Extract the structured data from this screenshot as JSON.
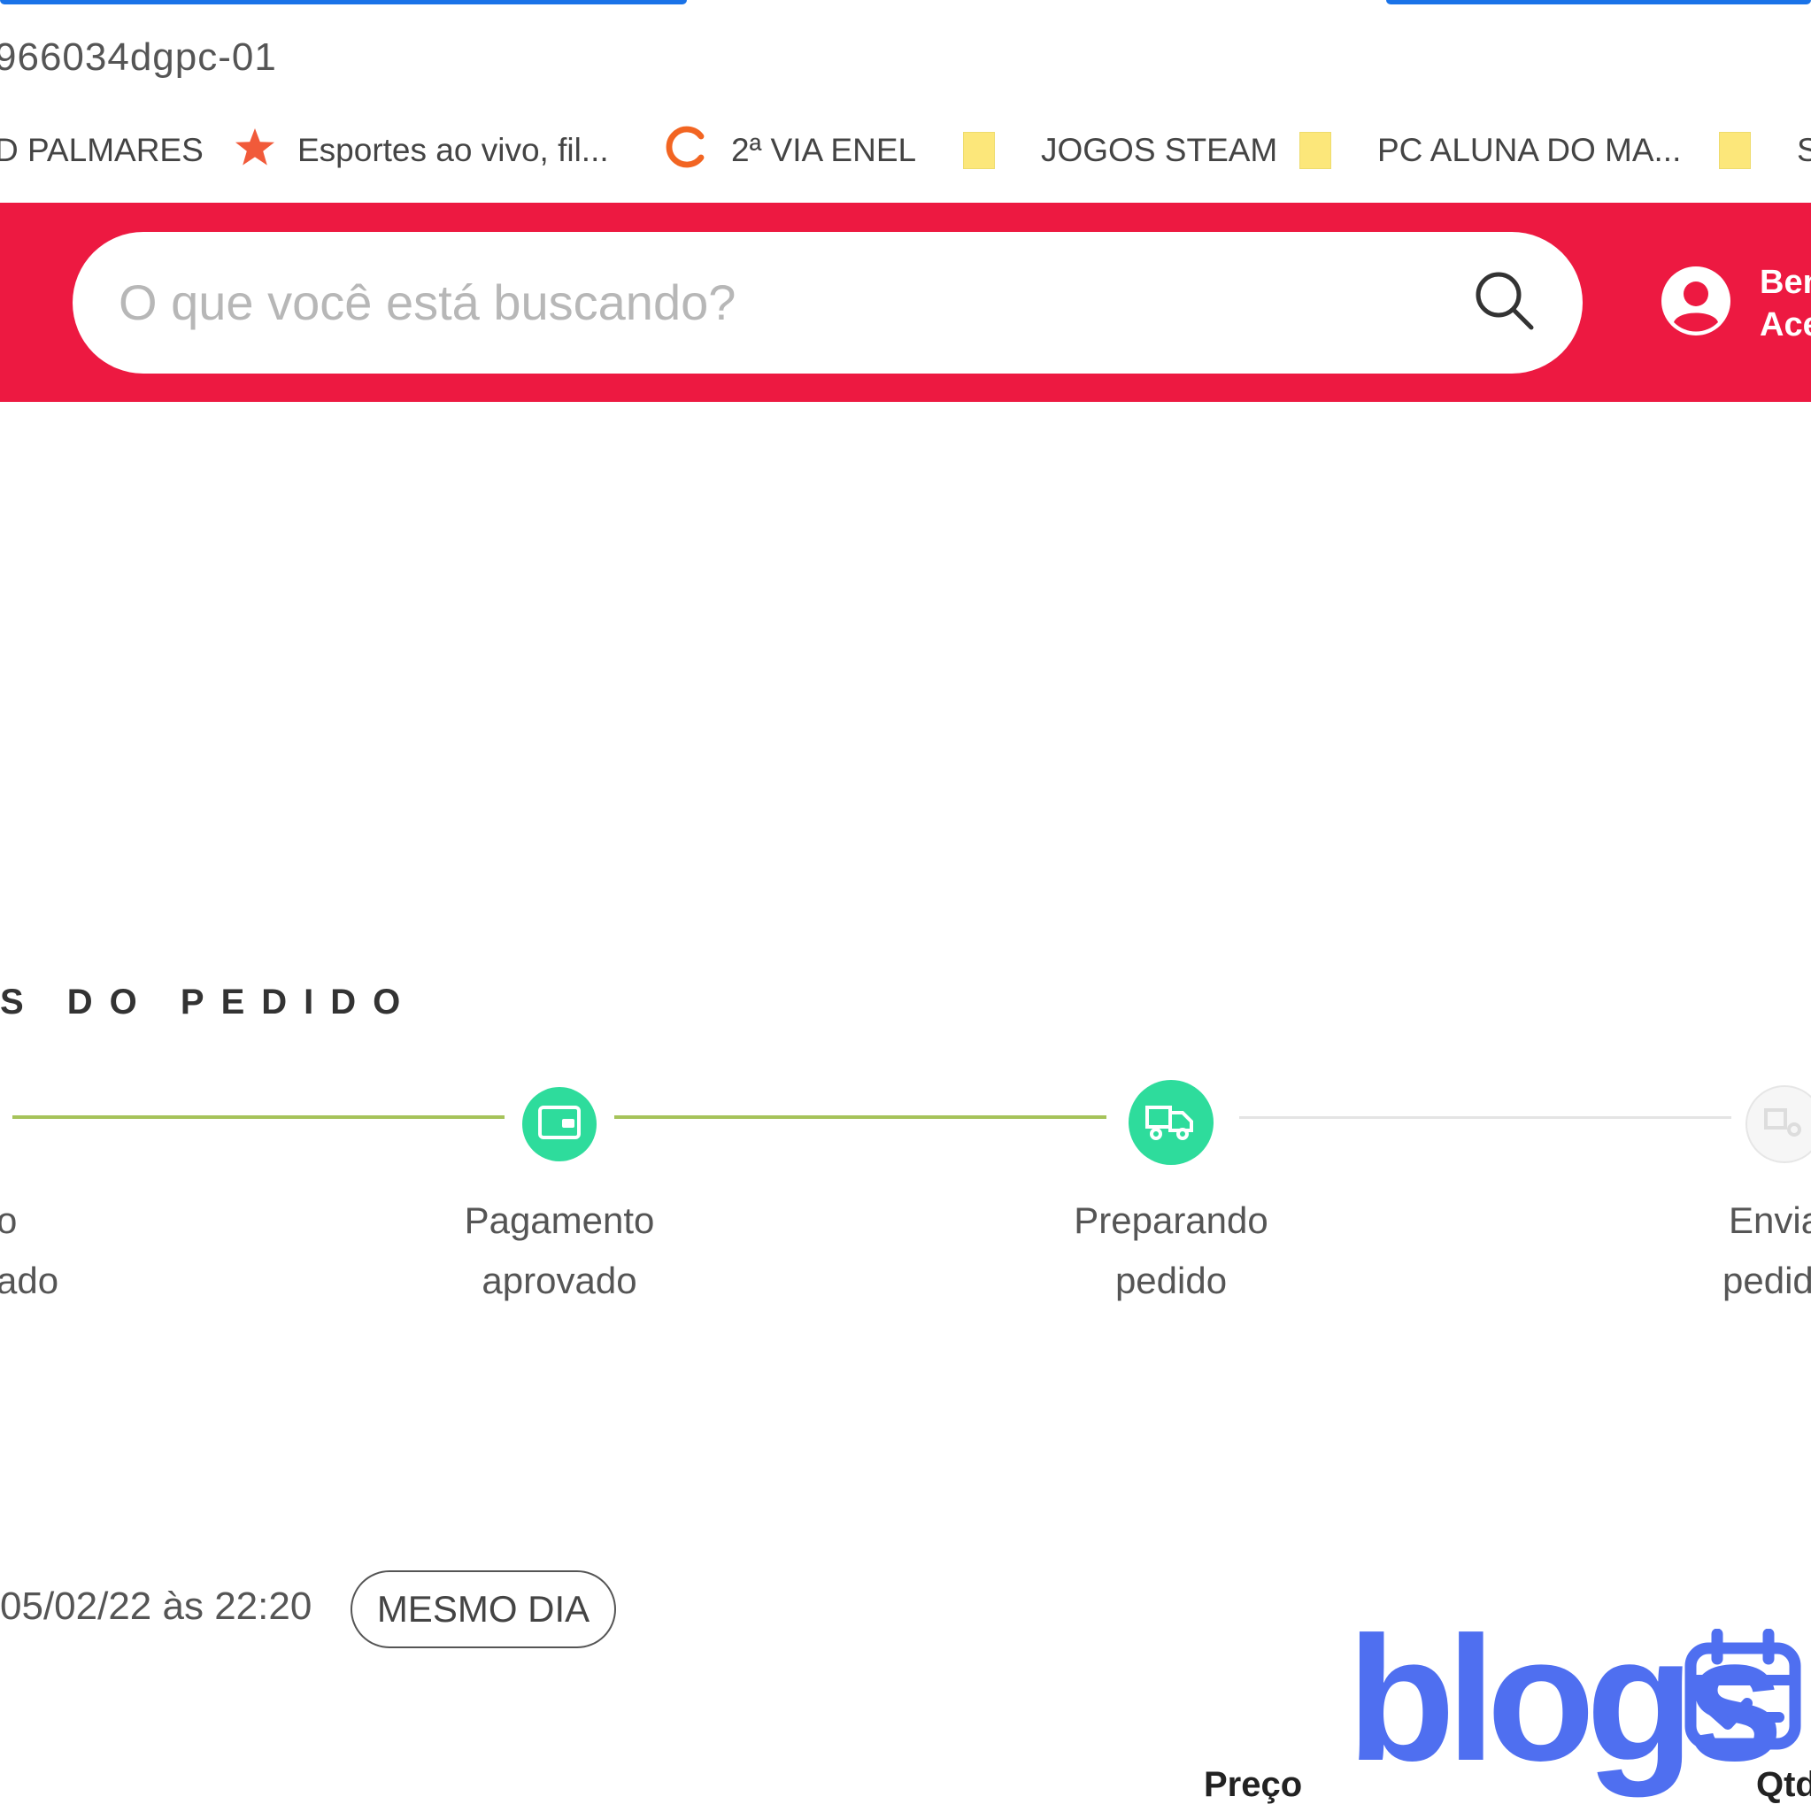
{
  "browser": {
    "url_fragment": "966034dgpc-01",
    "bookmarks": [
      {
        "label": "D PALMARES",
        "icon": "none"
      },
      {
        "label": "Esportes ao vivo, fil...",
        "icon": "star-icon"
      },
      {
        "label": "2ª VIA ENEL",
        "icon": "enel-logo-icon"
      },
      {
        "label": "JOGOS STEAM",
        "icon": "folder-icon"
      },
      {
        "label": "PC ALUNA DO MA...",
        "icon": "folder-icon"
      },
      {
        "label": "SE",
        "icon": "folder-icon"
      }
    ]
  },
  "header": {
    "search_placeholder": "O que você está buscando?",
    "greeting_line1": "Ben",
    "greeting_line2": "Ace",
    "brand_color": "#ed1941"
  },
  "order_status": {
    "title": "S DO PEDIDO",
    "steps": [
      {
        "label_line1": "o",
        "label_line2": "ado",
        "state": "done"
      },
      {
        "label_line1": "Pagamento",
        "label_line2": "aprovado",
        "state": "done",
        "icon": "wallet-icon"
      },
      {
        "label_line1": "Preparando",
        "label_line2": "pedido",
        "state": "current",
        "icon": "truck-icon"
      },
      {
        "label_line1": "Envia",
        "label_line2": "pedid",
        "state": "pending",
        "icon": "delivery-icon"
      }
    ],
    "done_color": "#2edc9c",
    "line_color": "#a6c35a"
  },
  "delivery": {
    "date_text": "05/02/22 às 22:20",
    "badge": "MESMO DIA"
  },
  "table": {
    "col_price": "Preço",
    "col_qty": "Qtd"
  },
  "watermark": {
    "text": "blogs"
  }
}
